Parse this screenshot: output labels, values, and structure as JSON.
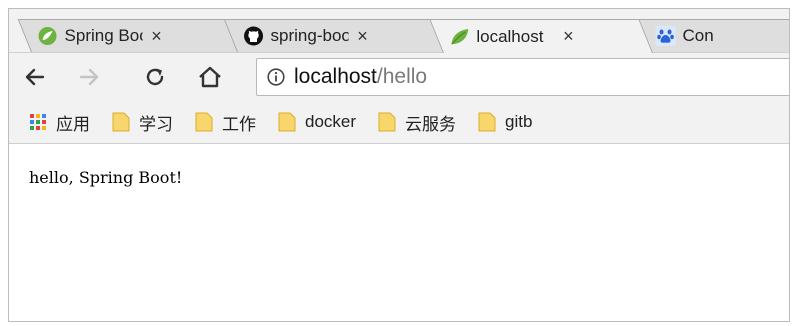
{
  "tabs": [
    {
      "title": "Spring Boot",
      "icon": "spring-boot-icon",
      "active": false
    },
    {
      "title": "spring-boot",
      "icon": "github-icon",
      "active": false
    },
    {
      "title": "localhost",
      "icon": "spring-leaf-icon",
      "active": true
    },
    {
      "title": "Con",
      "icon": "baidu-paw-icon",
      "active": false
    }
  ],
  "tab_close_glyph": "×",
  "toolbar": {
    "back_icon": "back-arrow-icon",
    "forward_icon": "forward-arrow-icon",
    "reload_icon": "reload-icon",
    "home_icon": "home-icon"
  },
  "address": {
    "host": "localhost",
    "path": "/hello",
    "info_icon": "info-icon"
  },
  "bookmarks": [
    {
      "label": "应用",
      "icon": "apps-grid-icon"
    },
    {
      "label": "学习",
      "icon": "folder-icon"
    },
    {
      "label": "工作",
      "icon": "folder-icon"
    },
    {
      "label": "docker",
      "icon": "folder-icon"
    },
    {
      "label": "云服务",
      "icon": "folder-icon"
    },
    {
      "label": "gitb",
      "icon": "folder-icon"
    }
  ],
  "page": {
    "body_text": "hello, Spring Boot!"
  },
  "colors": {
    "chrome_bg": "#f2f2f2",
    "inactive_tab": "#dedede",
    "spring_green": "#6db33f",
    "folder_yellow": "#f9d66b",
    "url_path_gray": "#7a7a7a"
  }
}
